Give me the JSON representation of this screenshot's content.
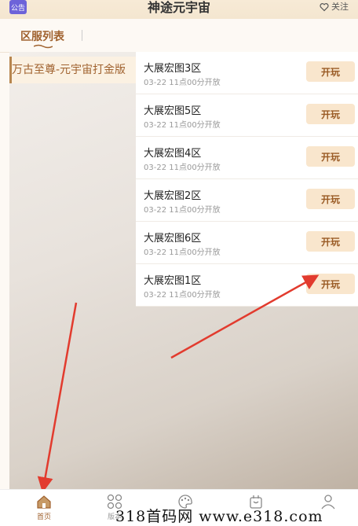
{
  "header": {
    "notice_label": "公告",
    "title": "神途元宇宙",
    "follow_label": "关注"
  },
  "tabs": [
    {
      "label": "区服列表"
    }
  ],
  "sidebar": {
    "selected_label": "万古至尊-元宇宙打金版"
  },
  "servers": [
    {
      "name": "大展宏图3区",
      "time": "03-22 11点00分开放",
      "button": "开玩"
    },
    {
      "name": "大展宏图5区",
      "time": "03-22 11点00分开放",
      "button": "开玩"
    },
    {
      "name": "大展宏图4区",
      "time": "03-22 11点00分开放",
      "button": "开玩"
    },
    {
      "name": "大展宏图2区",
      "time": "03-22 11点00分开放",
      "button": "开玩"
    },
    {
      "name": "大展宏图6区",
      "time": "03-22 11点00分开放",
      "button": "开玩"
    },
    {
      "name": "大展宏图1区",
      "time": "03-22 11点00分开放",
      "button": "开玩"
    }
  ],
  "bottom_nav": [
    {
      "label": "首页",
      "icon": "home-icon",
      "active": true
    },
    {
      "label": "版本",
      "icon": "grid-icon",
      "active": false
    },
    {
      "label": "",
      "icon": "palette-icon",
      "active": false
    },
    {
      "label": "",
      "icon": "gift-icon",
      "active": false
    },
    {
      "label": "",
      "icon": "user-icon",
      "active": false
    }
  ],
  "watermark": "318首码网  www.e318.com",
  "colors": {
    "accent": "#a0622f",
    "button_bg": "#f9e6cd",
    "notice_bg": "#6d63d9",
    "arrow": "#e23b2e"
  }
}
